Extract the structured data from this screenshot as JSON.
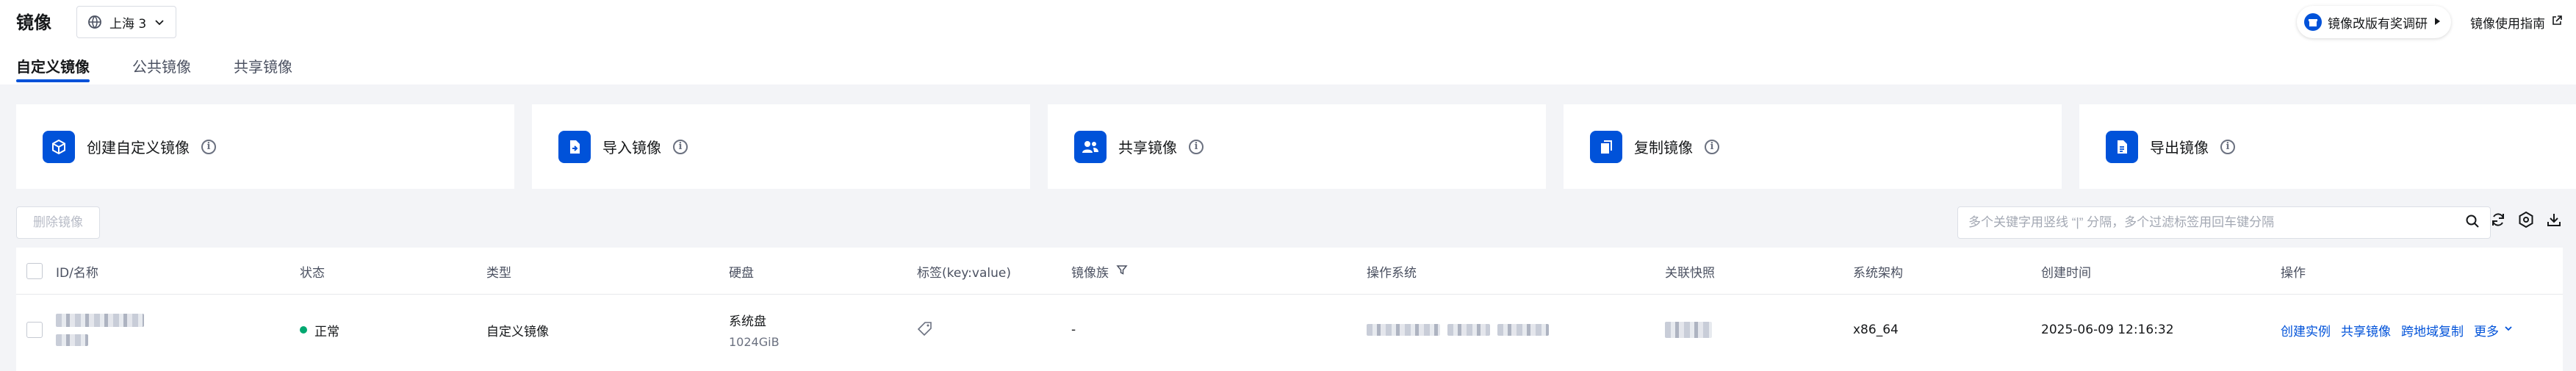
{
  "header": {
    "title": "镜像",
    "region": "上海 3",
    "survey_label": "镜像改版有奖调研",
    "guide_label": "镜像使用指南"
  },
  "tabs": [
    {
      "label": "自定义镜像",
      "active": true
    },
    {
      "label": "公共镜像",
      "active": false
    },
    {
      "label": "共享镜像",
      "active": false
    }
  ],
  "actions": [
    {
      "label": "创建自定义镜像",
      "icon": "cube-icon"
    },
    {
      "label": "导入镜像",
      "icon": "import-file-icon"
    },
    {
      "label": "共享镜像",
      "icon": "users-icon"
    },
    {
      "label": "复制镜像",
      "icon": "copy-icon"
    },
    {
      "label": "导出镜像",
      "icon": "export-file-icon"
    }
  ],
  "toolbar": {
    "delete_label": "删除镜像",
    "search_placeholder": "多个关键字用竖线 “|” 分隔，多个过滤标签用回车键分隔"
  },
  "table": {
    "columns": [
      "ID/名称",
      "状态",
      "类型",
      "硬盘",
      "标签(key:value)",
      "镜像族",
      "操作系统",
      "关联快照",
      "系统架构",
      "创建时间",
      "操作"
    ],
    "rows": [
      {
        "status": "正常",
        "type": "自定义镜像",
        "disk_type": "系统盘",
        "disk_size": "1024GiB",
        "family": "-",
        "arch": "x86_64",
        "created": "2025-06-09 12:16:32",
        "ops": [
          "创建实例",
          "共享镜像",
          "跨地域复制",
          "更多"
        ]
      }
    ]
  },
  "colors": {
    "primary": "#0052d9",
    "status_normal": "#00a870",
    "background": "#f3f4f7"
  }
}
